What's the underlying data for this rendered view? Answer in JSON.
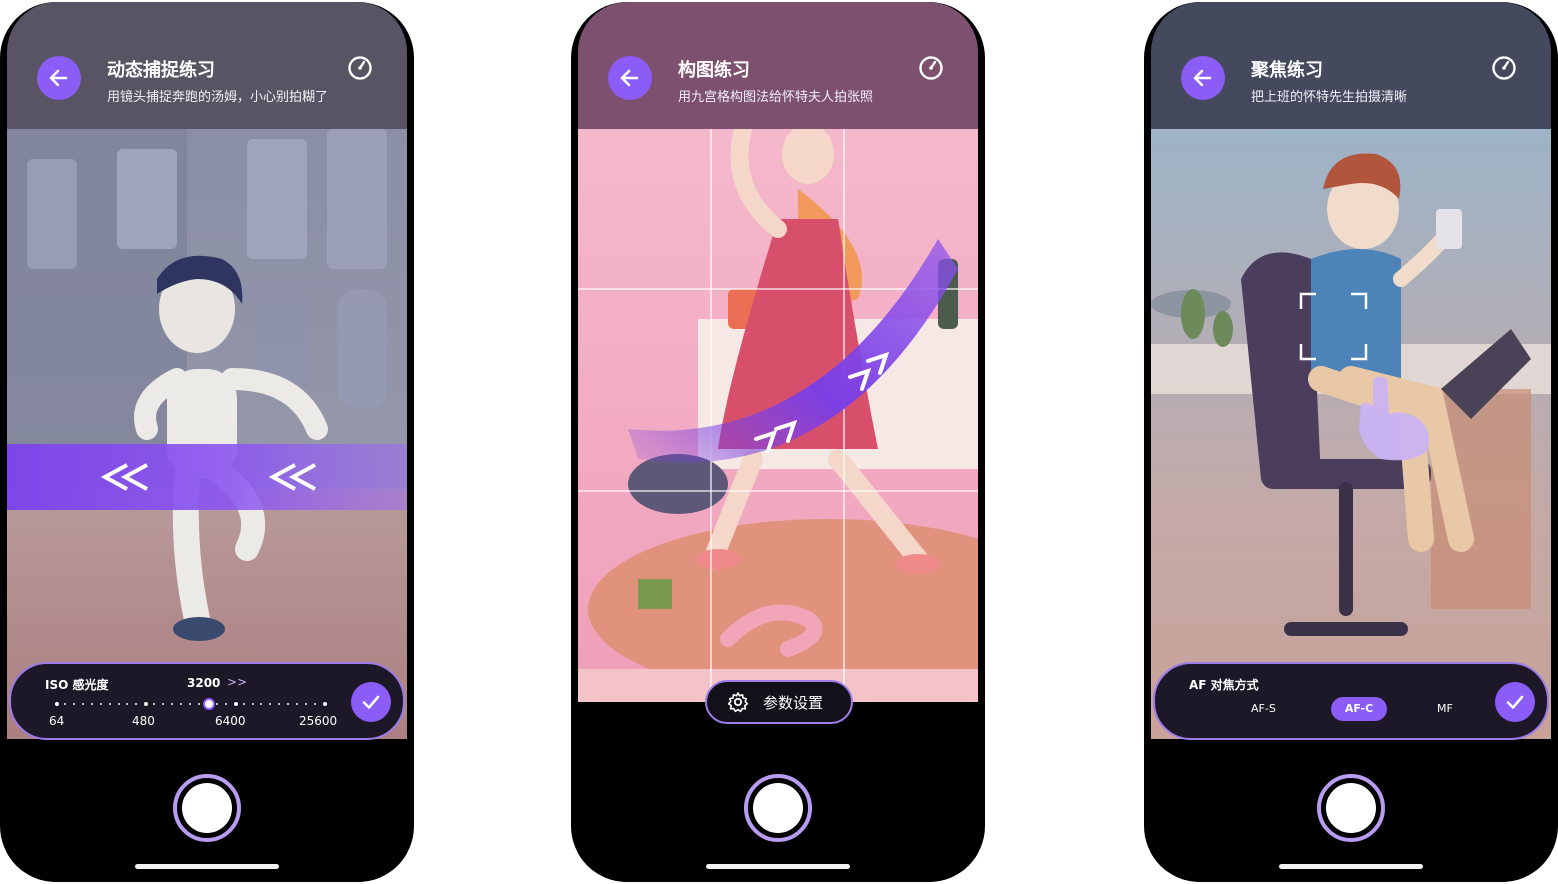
{
  "phones": [
    {
      "title": "动态捕捉练习",
      "subtitle": "用镜头捕捉奔跑的汤姆，小心别拍糊了",
      "control": {
        "label": "ISO 感光度",
        "current_value": "3200",
        "scale_labels": [
          "64",
          "480",
          "6400",
          "25600"
        ]
      }
    },
    {
      "title": "构图练习",
      "subtitle": "用九宫格构图法给怀特夫人拍张照",
      "settings_label": "参数设置"
    },
    {
      "title": "聚焦练习",
      "subtitle": "把上班的怀特先生拍摄清晰",
      "control": {
        "label": "AF 对焦方式",
        "options": [
          "AF-S",
          "AF-C",
          "MF"
        ],
        "selected": "AF-C"
      }
    }
  ],
  "colors": {
    "accent": "#8b5cf6",
    "accent_light": "#b79cf2",
    "panel_bg": "#1c1828"
  },
  "icons": [
    "arrow-left-icon",
    "timer-icon",
    "checkmark-icon",
    "gear-icon",
    "focus-bracket-icon",
    "hand-pointer-icon"
  ]
}
